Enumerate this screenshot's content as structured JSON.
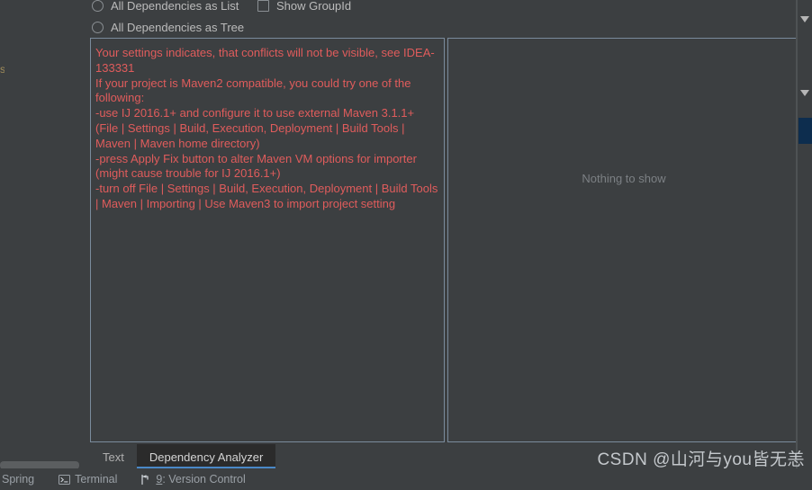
{
  "options": {
    "radios": [
      {
        "label": "All Dependencies as List",
        "selected": false
      },
      {
        "label": "All Dependencies as Tree",
        "selected": false
      }
    ],
    "checkbox": {
      "label": "Show GroupId",
      "checked": false
    }
  },
  "left_panel": {
    "warning_text": "Your settings indicates, that conflicts will not be visible, see IDEA-133331\nIf your project is Maven2 compatible, you could try one of the following:\n-use IJ 2016.1+ and configure it to use external Maven 3.1.1+ (File | Settings | Build, Execution, Deployment | Build Tools | Maven | Maven home directory)\n-press Apply Fix button to alter Maven VM options for importer (might cause trouble for IJ 2016.1+)\n-turn off File | Settings | Build, Execution, Deployment | Build Tools | Maven | Importing | Use Maven3 to import project setting",
    "warning_color": "#e05c5c"
  },
  "right_panel": {
    "empty_message": "Nothing to show"
  },
  "tabs": [
    {
      "label": "Text",
      "active": false
    },
    {
      "label": "Dependency Analyzer",
      "active": true
    }
  ],
  "tab_accent_color": "#4a88c7",
  "statusbar": {
    "items": [
      {
        "label": "Spring",
        "icon": "none"
      },
      {
        "label": "Terminal",
        "icon": "terminal-icon"
      },
      {
        "label": "9: Version Control",
        "icon": "branch-icon"
      }
    ]
  },
  "gutter": {
    "marker_color": "#b6b6b6",
    "highlight_color": "#0d2d4e"
  },
  "left_edge_fragment": "s",
  "watermark": "CSDN @山河与you皆无恙",
  "theme": {
    "background": "#3c3f41",
    "panel_border": "#7a8b9c",
    "tab_active_background": "#2b2b2b",
    "text": "#a9b7c6"
  }
}
